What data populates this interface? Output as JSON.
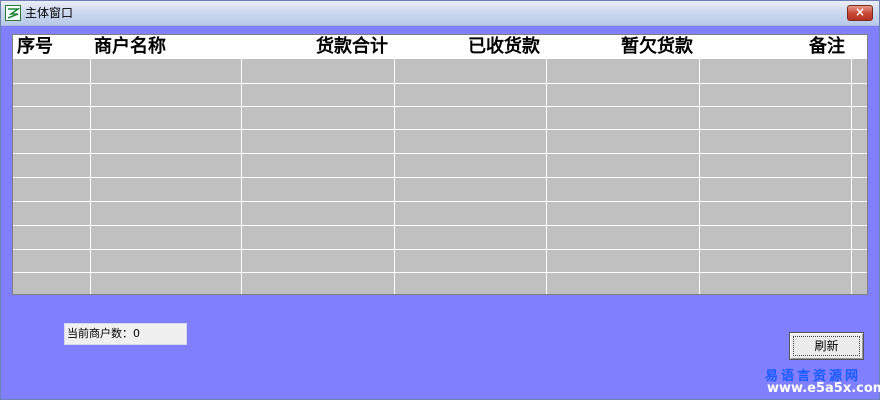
{
  "window": {
    "title": "主体窗口",
    "close_label": "×"
  },
  "table": {
    "columns": [
      "序号",
      "商户名称",
      "货款合计",
      "已收货款",
      "暂欠货款",
      "备注"
    ],
    "rows": []
  },
  "status": {
    "count_label": "当前商户数：0"
  },
  "toolbar": {
    "refresh_label": "刷新"
  },
  "watermark": {
    "chinese": "易语言资源网",
    "url": "www.e5a5x.com"
  },
  "colors": {
    "background": "#8080ff",
    "grid": "#c0c0c0",
    "header": "#ffffff"
  }
}
